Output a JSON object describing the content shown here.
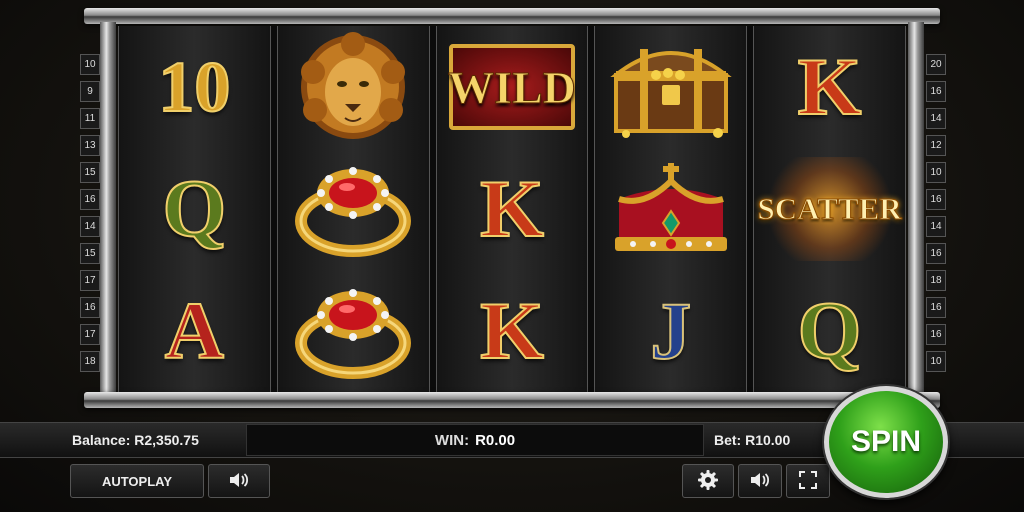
{
  "reels": [
    [
      {
        "type": "text",
        "value": "10",
        "cls": "ten"
      },
      {
        "type": "text",
        "value": "Q",
        "cls": "q"
      },
      {
        "type": "text",
        "value": "A",
        "cls": "a"
      }
    ],
    [
      {
        "type": "lion"
      },
      {
        "type": "ring"
      },
      {
        "type": "ring"
      }
    ],
    [
      {
        "type": "wild",
        "value": "WILD"
      },
      {
        "type": "text",
        "value": "K",
        "cls": "k"
      },
      {
        "type": "text",
        "value": "K",
        "cls": "k"
      }
    ],
    [
      {
        "type": "chest"
      },
      {
        "type": "crown"
      },
      {
        "type": "text",
        "value": "J",
        "cls": "j"
      }
    ],
    [
      {
        "type": "text",
        "value": "K",
        "cls": "k"
      },
      {
        "type": "scatter",
        "value": "SCATTER"
      },
      {
        "type": "text",
        "value": "Q",
        "cls": "q"
      }
    ]
  ],
  "paylines_left": [
    "10",
    "9",
    "11",
    "13",
    "15",
    "16",
    "14",
    "15",
    "17",
    "16",
    "17",
    "18"
  ],
  "paylines_right": [
    "20",
    "16",
    "14",
    "12",
    "10",
    "16",
    "14",
    "16",
    "18",
    "16",
    "16",
    "10"
  ],
  "status": {
    "balance": "Balance: R2,350.75",
    "win_label": "WIN:",
    "win_value": "R0.00",
    "bet": "Bet: R10.00"
  },
  "controls": {
    "autoplay": "AUTOPLAY",
    "spin": "SPIN",
    "icons": [
      "speaker-icon",
      "gear-icon",
      "speaker-icon",
      "fullscreen-icon"
    ]
  },
  "colors": {
    "spin_green": "#2fa01a",
    "gold": "#d9a22a",
    "ruby": "#c8141c"
  }
}
